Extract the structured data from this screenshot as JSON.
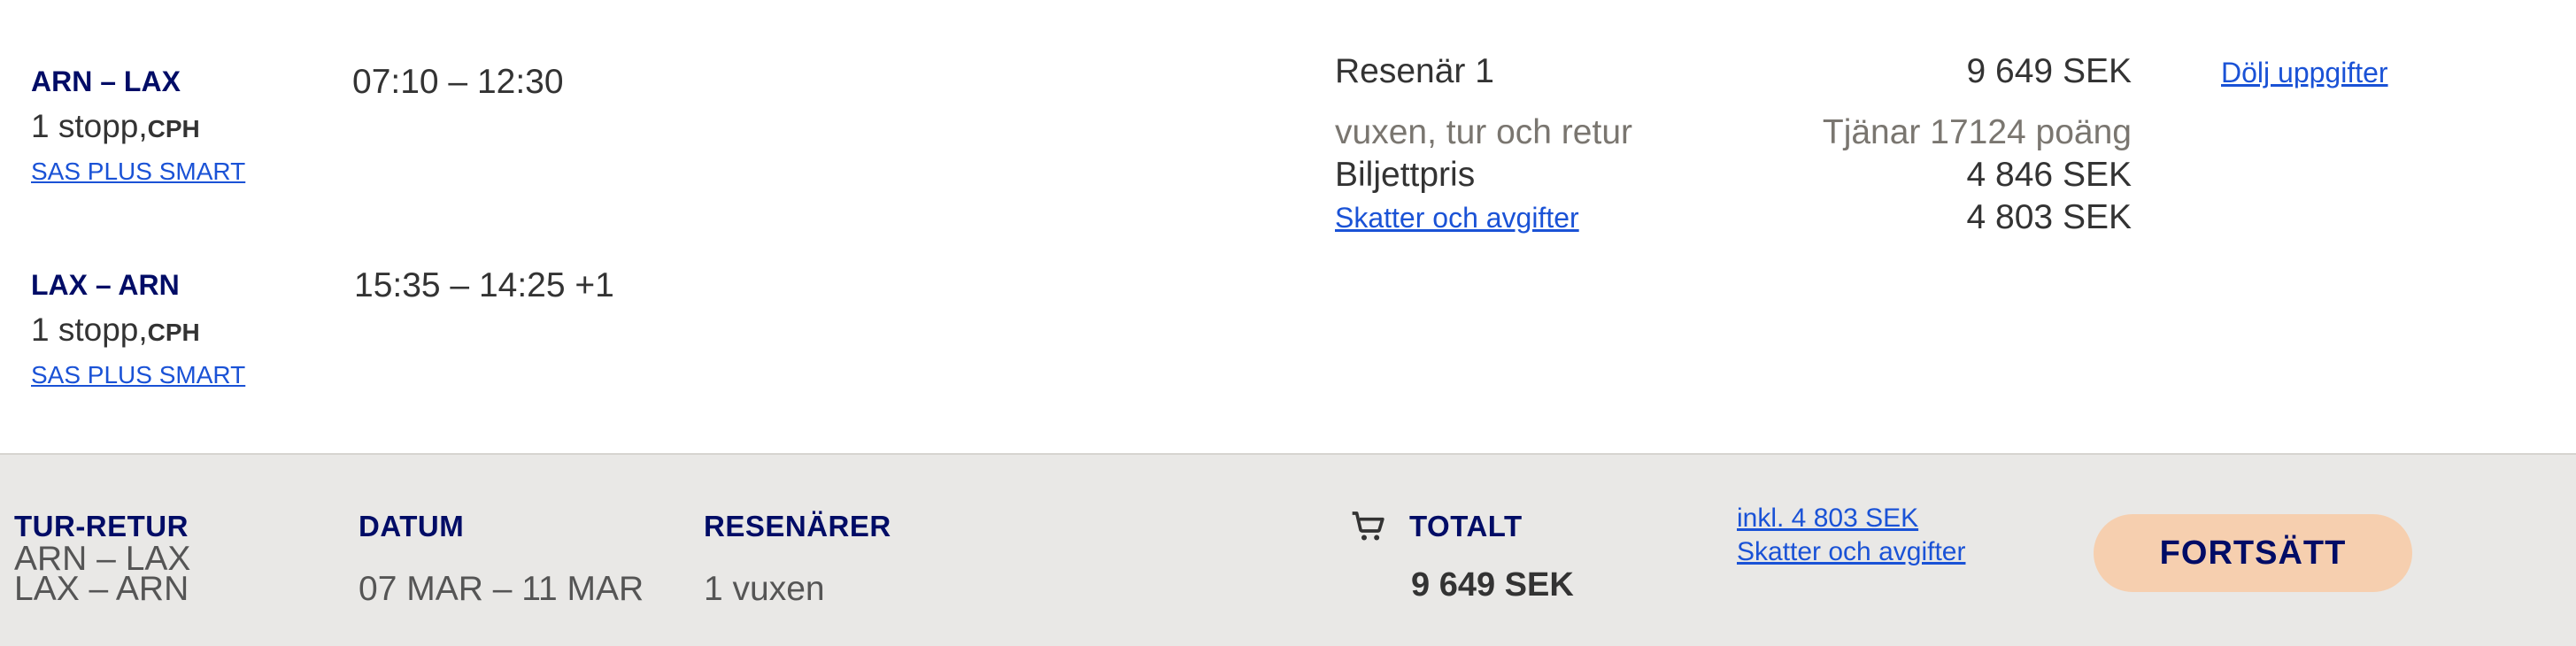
{
  "itinerary": {
    "segments": [
      {
        "route": "ARN – LAX",
        "stops": "1 stopp,",
        "via": "CPH",
        "fare": "SAS PLUS SMART",
        "time": "07:10 – 12:30"
      },
      {
        "route": "LAX – ARN",
        "stops": "1 stopp,",
        "via": "CPH",
        "fare": "SAS PLUS SMART",
        "time": "15:35 – 14:25 +1"
      }
    ]
  },
  "passenger": {
    "title": "Resenär 1",
    "total": "9 649 SEK",
    "toggle_label": "Dölj uppgifter",
    "type": "vuxen, tur och retur",
    "points": "Tjänar 17124 poäng",
    "ticket_label": "Biljettpris",
    "ticket_price": "4 846 SEK",
    "taxes_label": "Skatter och avgifter",
    "taxes_price": "4 803 SEK"
  },
  "summary": {
    "trip_label": "TUR-RETUR",
    "trip_route_out": "ARN – LAX",
    "trip_route_back": "LAX – ARN",
    "date_label": "DATUM",
    "date_value": "07 MAR – 11 MAR",
    "travellers_label": "RESENÄRER",
    "travellers_value": "1 vuxen",
    "cart_icon": "shopping-cart-icon",
    "total_label": "TOTALT",
    "total_value": "9 649 SEK",
    "incl_taxes": "inkl. 4 803 SEK",
    "taxes_link": "Skatter och avgifter",
    "continue_label": "FORTSÄTT"
  },
  "colors": {
    "navy": "#000c66",
    "link": "#1a52d6",
    "summary_bg": "#e9e8e6",
    "cta_bg": "#f6cfaf"
  }
}
